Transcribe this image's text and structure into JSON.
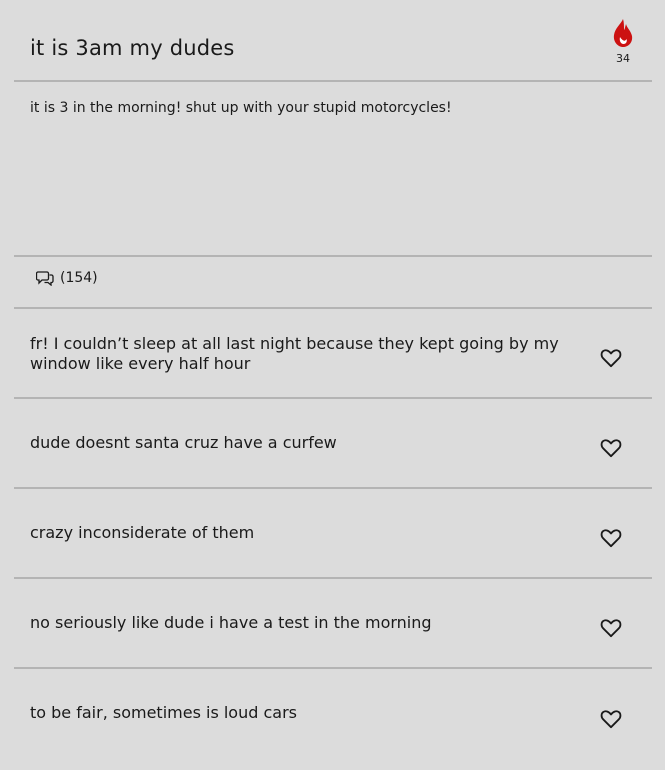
{
  "post": {
    "title": "it is 3am my dudes",
    "body": "it is 3 in the morning! shut up with your stupid motorcycles!",
    "votes": "34",
    "comment_count": "(154)"
  },
  "colors": {
    "flame": "#cc1111",
    "divider": "#b4b4b4",
    "background": "#dcdcdc"
  },
  "icons": {
    "vote": "flame-icon",
    "comments": "comments-icon",
    "like": "heart-outline-icon"
  },
  "comments": [
    {
      "text": "fr! I couldn’t sleep at all last night because they kept going by my window like every half hour"
    },
    {
      "text": "dude doesnt santa cruz have a curfew"
    },
    {
      "text": "crazy inconsiderate of them"
    },
    {
      "text": "no seriously like dude i have a test in the morning"
    },
    {
      "text": "to be fair, sometimes is loud cars"
    }
  ]
}
